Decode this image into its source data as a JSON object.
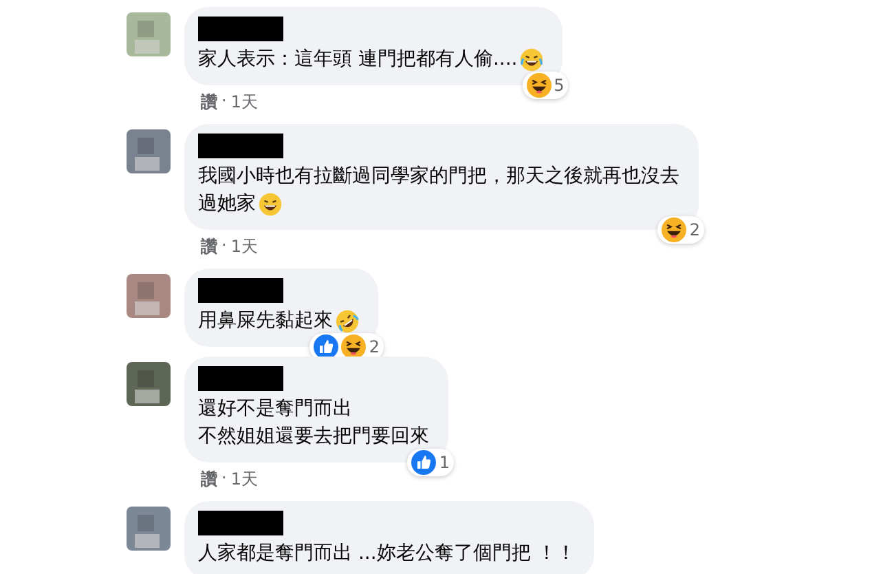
{
  "comments": [
    {
      "avatar": {
        "color": "#a8b89a"
      },
      "lines": [
        "家人表示：這年頭 連門把都有人偷...."
      ],
      "emoji": {
        "kind": "tears"
      },
      "reactions": [
        {
          "kind": "haha",
          "count": "5"
        }
      ],
      "meta": {
        "like": "讚",
        "sep": "·",
        "time": "1天"
      }
    },
    {
      "avatar": {
        "color": "#7a8290"
      },
      "lines": [
        "我國小時也有拉斷過同學家的門把，那天之後就再也沒去",
        "過她家"
      ],
      "emoji": {
        "kind": "grin"
      },
      "reactions": [
        {
          "kind": "haha",
          "count": "2"
        }
      ],
      "meta": {
        "like": "讚",
        "sep": "·",
        "time": "1天"
      }
    },
    {
      "avatar": {
        "color": "#a88880"
      },
      "lines": [
        "用鼻屎先黏起來"
      ],
      "emoji": {
        "kind": "rolling"
      },
      "reactions": [
        {
          "kind": "like"
        },
        {
          "kind": "haha",
          "count": "2"
        }
      ]
    },
    {
      "avatar": {
        "color": "#5e6656"
      },
      "lines": [
        "還好不是奪門而出",
        "不然姐姐還要去把門要回來"
      ],
      "reactions": [
        {
          "kind": "like",
          "count": "1"
        }
      ],
      "meta": {
        "like": "讚",
        "sep": "·",
        "time": "1天"
      }
    },
    {
      "avatar": {
        "color": "#7d8896"
      },
      "lines": [
        "人家都是奪門而出 ...妳老公奪了個門把 ！！"
      ]
    }
  ]
}
